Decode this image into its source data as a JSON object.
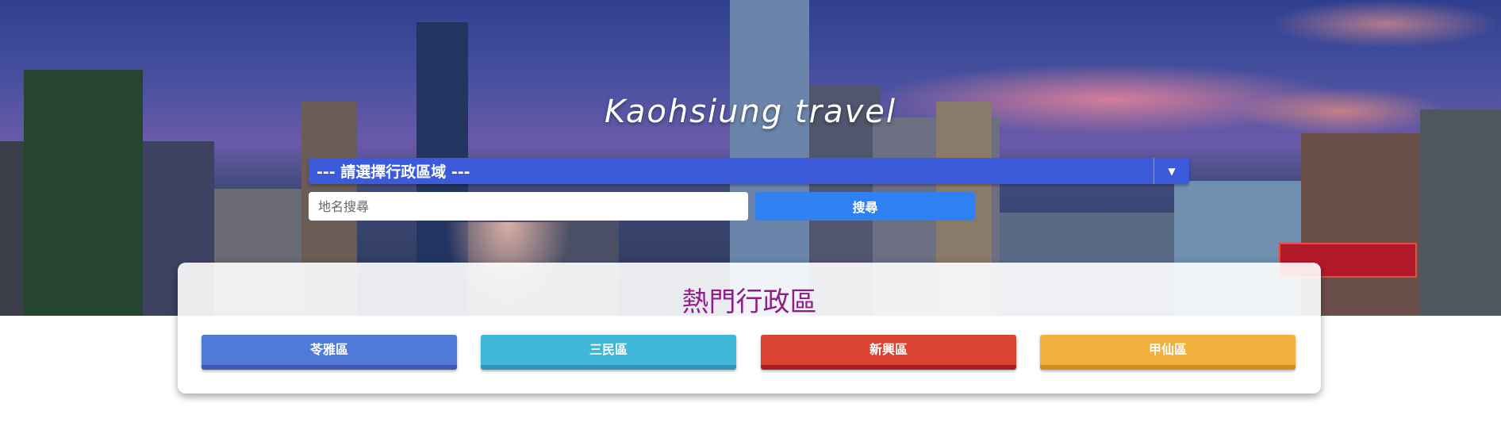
{
  "header": {
    "title": "Kaohsiung travel"
  },
  "district_select": {
    "selected_label": "--- 請選擇行政區域 ---",
    "arrow_icon": "caret-down-icon"
  },
  "search": {
    "placeholder": "地名搜尋",
    "value": "",
    "button_label": "搜尋"
  },
  "popular": {
    "title": "熱門行政區",
    "districts": [
      {
        "label": "苓雅區",
        "color": "#4f7ad8"
      },
      {
        "label": "三民區",
        "color": "#3fb7d8"
      },
      {
        "label": "新興區",
        "color": "#d9432f"
      },
      {
        "label": "甲仙區",
        "color": "#f3b03d"
      }
    ]
  }
}
